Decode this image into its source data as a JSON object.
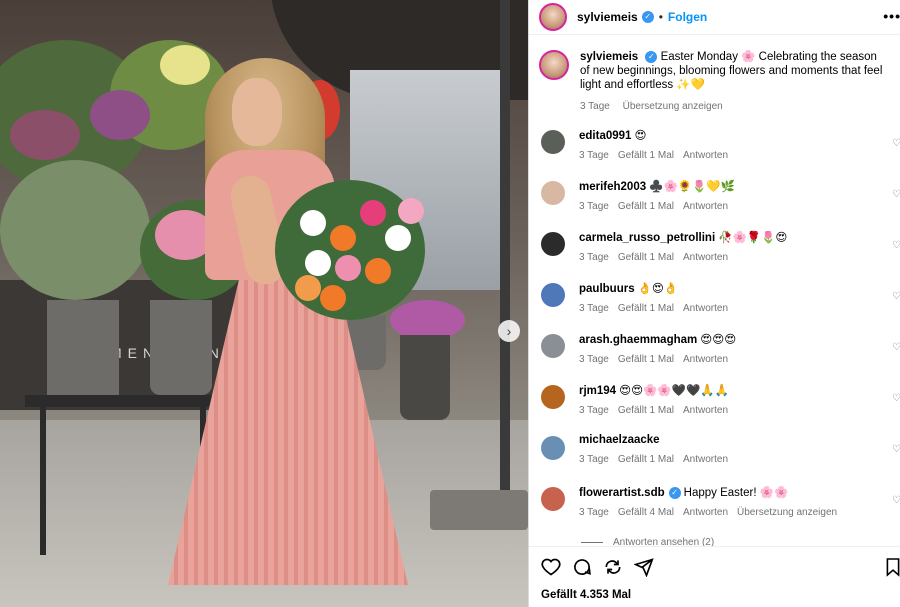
{
  "post": {
    "username": "sylviemeis",
    "follow_label": "Folgen",
    "dot": "•",
    "more_label": "•••",
    "shop_sign": "MENʼ  LON",
    "next_label": "›"
  },
  "caption": {
    "username": "sylviemeis",
    "text": "Easter Monday 🌸 Celebrating the season of new beginnings, blooming flowers and moments that feel light and effortless ✨💛",
    "time": "3 Tage",
    "translate": "Übersetzung anzeigen"
  },
  "comments": [
    {
      "user": "edita0991",
      "text": "😍",
      "time": "3 Tage",
      "likes": "Gefällt 1 Mal",
      "reply": "Antworten",
      "translate": "",
      "avatar_color": "#5a5f58"
    },
    {
      "user": "merifeh2003",
      "text": "♣️🌸🌻🌷💛🌿",
      "time": "3 Tage",
      "likes": "Gefällt 1 Mal",
      "reply": "Antworten",
      "translate": "",
      "avatar_color": "#d8b8a3"
    },
    {
      "user": "carmela_russo_petrollini",
      "text": "🥀🌸🌹🌷😍",
      "time": "3 Tage",
      "likes": "Gefällt 1 Mal",
      "reply": "Antworten",
      "translate": "",
      "avatar_color": "#2b2b2b"
    },
    {
      "user": "paulbuurs",
      "text": "👌😍👌",
      "time": "3 Tage",
      "likes": "Gefällt 1 Mal",
      "reply": "Antworten",
      "translate": "",
      "avatar_color": "#4f78b8"
    },
    {
      "user": "arash.ghaemmagham",
      "text": "😍😍😍",
      "time": "3 Tage",
      "likes": "Gefällt 1 Mal",
      "reply": "Antworten",
      "translate": "",
      "avatar_color": "#8a8f96"
    },
    {
      "user": "rjm194",
      "text": "😍😍🌸🌸🖤🖤🙏🙏",
      "time": "3 Tage",
      "likes": "Gefällt 1 Mal",
      "reply": "Antworten",
      "translate": "",
      "avatar_color": "#b5651d"
    },
    {
      "user": "michaelzaacke",
      "text": "",
      "time": "3 Tage",
      "likes": "Gefällt 1 Mal",
      "reply": "Antworten",
      "translate": "",
      "avatar_color": "#6a8fb5"
    },
    {
      "user": "flowerartist.sdb",
      "text": "Happy Easter! 🌸🌸",
      "time": "3 Tage",
      "likes": "Gefällt 4 Mal",
      "reply": "Antworten",
      "translate": "Übersetzung anzeigen",
      "avatar_color": "#c7624f",
      "verified": true
    }
  ],
  "view_replies": "Antworten ansehen (2)",
  "likes_text": "Gefällt 4.353 Mal",
  "verified_mark": "✓",
  "heart_small": "♡",
  "colors": {
    "link_blue": "#0095f6",
    "verified_blue": "#3897f0",
    "meta_gray": "#737373",
    "dress_pink": "#eaa39b"
  },
  "icons": [
    "heart-icon",
    "comment-icon",
    "share-icon",
    "send-icon",
    "bookmark-icon",
    "more-icon",
    "verified-icon",
    "next-arrow-icon"
  ]
}
